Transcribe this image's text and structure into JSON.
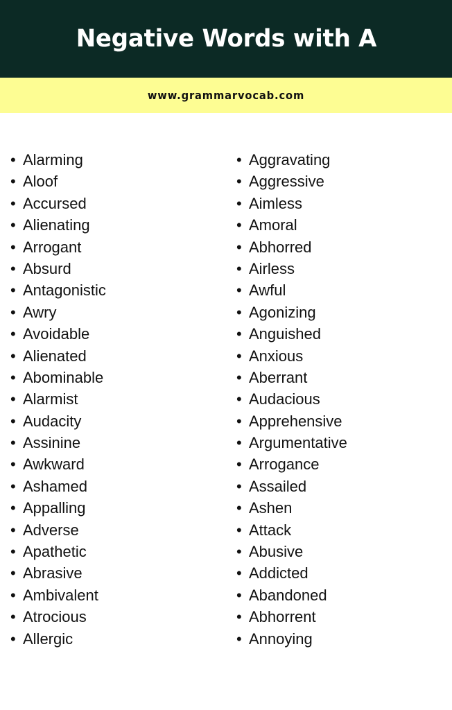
{
  "header": {
    "title": "Negative Words with A",
    "background_color": "#0c2a25",
    "text_color": "#ffffff"
  },
  "url_bar": {
    "url": "www.grammarvocab.com",
    "background_color": "#fdfd93",
    "text_color": "#111111"
  },
  "bullet": {
    "glyph": "•"
  },
  "lists": {
    "left_column": [
      "Alarming",
      "Aloof",
      "Accursed",
      "Alienating",
      "Arrogant",
      "Absurd",
      "Antagonistic",
      "Awry",
      "Avoidable",
      "Alienated",
      "Abominable",
      "Alarmist",
      "Audacity",
      "Assinine",
      "Awkward",
      "Ashamed",
      "Appalling",
      "Adverse",
      "Apathetic",
      "Abrasive",
      "Ambivalent",
      "Atrocious",
      "Allergic"
    ],
    "right_column": [
      "Aggravating",
      "Aggressive",
      "Aimless",
      "Amoral",
      "Abhorred",
      "Airless",
      "Awful",
      "Agonizing",
      "Anguished",
      "Anxious",
      "Aberrant",
      "Audacious",
      "Apprehensive",
      "Argumentative",
      "Arrogance",
      "Assailed",
      "Ashen",
      "Attack",
      "Abusive",
      "Addicted",
      "Abandoned",
      "Abhorrent",
      "Annoying"
    ]
  }
}
